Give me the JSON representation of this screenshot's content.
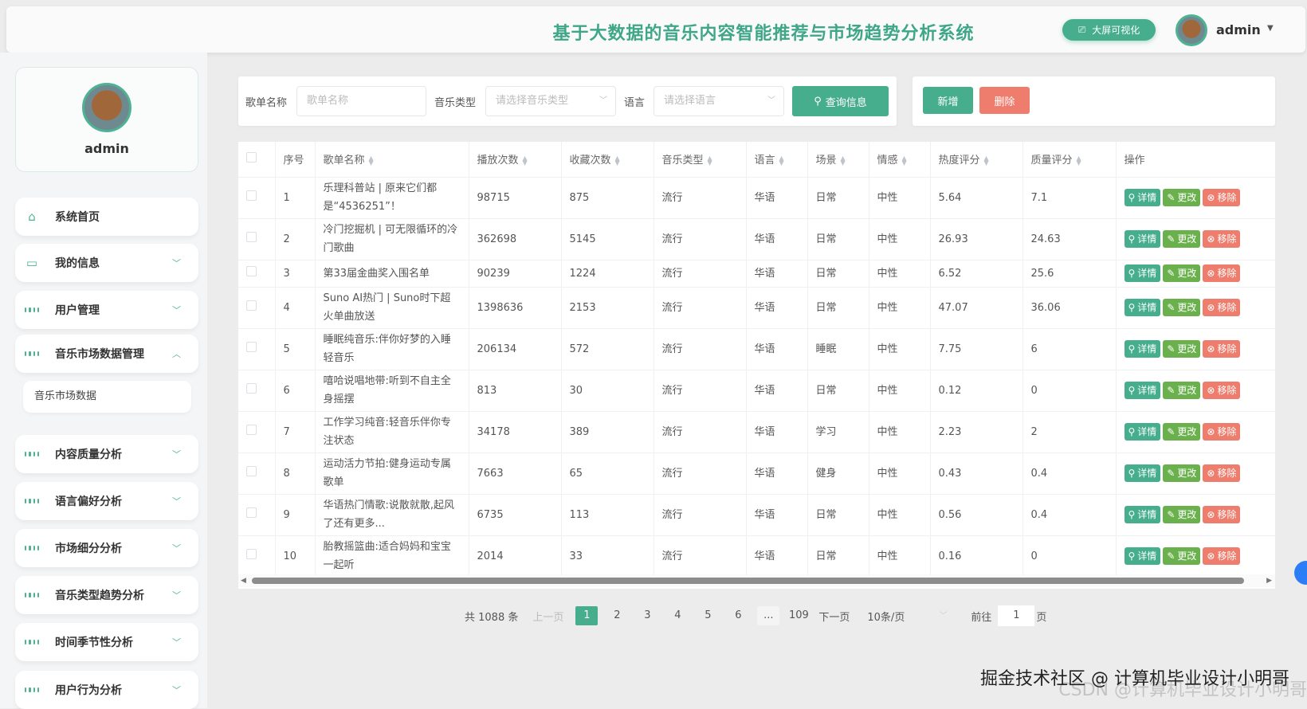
{
  "header": {
    "title": "基于大数据的音乐内容智能推荐与市场趋势分析系统",
    "bigscreen_label": "大屏可视化",
    "username": "admin"
  },
  "sidebar": {
    "profile_name": "admin",
    "items": [
      {
        "label": "系统首页"
      },
      {
        "label": "我的信息"
      },
      {
        "label": "用户管理"
      },
      {
        "label": "音乐市场数据管理"
      },
      {
        "label": "内容质量分析"
      },
      {
        "label": "语言偏好分析"
      },
      {
        "label": "市场细分分析"
      },
      {
        "label": "音乐类型趋势分析"
      },
      {
        "label": "时间季节性分析"
      },
      {
        "label": "用户行为分析"
      }
    ],
    "submenu": [
      "音乐市场数据"
    ]
  },
  "search": {
    "name_label": "歌单名称",
    "name_placeholder": "歌单名称",
    "type_label": "音乐类型",
    "type_placeholder": "请选择音乐类型",
    "lang_label": "语言",
    "lang_placeholder": "请选择语言",
    "query_label": "查询信息"
  },
  "actions": {
    "add_label": "新增",
    "delete_label": "删除"
  },
  "table": {
    "columns": [
      "序号",
      "歌单名称",
      "播放次数",
      "收藏次数",
      "音乐类型",
      "语言",
      "场景",
      "情感",
      "热度评分",
      "质量评分",
      "操作"
    ],
    "op_labels": {
      "detail": "详情",
      "edit": "更改",
      "remove": "移除"
    },
    "rows": [
      [
        "1",
        "乐理科普站 | 原来它们都是“4536251”！",
        "98715",
        "875",
        "流行",
        "华语",
        "日常",
        "中性",
        "5.64",
        "7.1"
      ],
      [
        "2",
        "冷门挖掘机 | 可无限循环的冷门歌曲",
        "362698",
        "5145",
        "流行",
        "华语",
        "日常",
        "中性",
        "26.93",
        "24.63"
      ],
      [
        "3",
        "第33届金曲奖入围名单",
        "90239",
        "1224",
        "流行",
        "华语",
        "日常",
        "中性",
        "6.52",
        "25.6"
      ],
      [
        "4",
        "Suno AI热门 | Suno时下超火单曲放送",
        "1398636",
        "2153",
        "流行",
        "华语",
        "日常",
        "中性",
        "47.07",
        "36.06"
      ],
      [
        "5",
        "睡眠纯音乐:伴你好梦的入睡轻音乐",
        "206134",
        "572",
        "流行",
        "华语",
        "睡眠",
        "中性",
        "7.75",
        "6"
      ],
      [
        "6",
        "嘻哈说唱地带:听到不自主全身摇摆",
        "813",
        "30",
        "流行",
        "华语",
        "日常",
        "中性",
        "0.12",
        "0"
      ],
      [
        "7",
        "工作学习纯音:轻音乐伴你专注状态",
        "34178",
        "389",
        "流行",
        "华语",
        "学习",
        "中性",
        "2.23",
        "2"
      ],
      [
        "8",
        "运动活力节拍:健身运动专属歌单",
        "7663",
        "65",
        "流行",
        "华语",
        "健身",
        "中性",
        "0.43",
        "0.4"
      ],
      [
        "9",
        "华语热门情歌:说散就散,起风了还有更多...",
        "6735",
        "113",
        "流行",
        "华语",
        "日常",
        "中性",
        "0.56",
        "0.4"
      ],
      [
        "10",
        "胎教摇篮曲:适合妈妈和宝宝一起听",
        "2014",
        "33",
        "流行",
        "华语",
        "日常",
        "中性",
        "0.16",
        "0"
      ]
    ]
  },
  "pagination": {
    "total": "共 1088 条",
    "prev": "上一页",
    "pages": [
      "1",
      "2",
      "3",
      "4",
      "5",
      "6"
    ],
    "ellipsis": "...",
    "last": "109",
    "next": "下一页",
    "page_size": "10条/页",
    "goto_label": "前往",
    "goto_value": "1",
    "goto_suffix": "页",
    "current_page": 1
  },
  "watermark": {
    "line1": "掘金技术社区 @ 计算机毕业设计小明哥",
    "line2": "CSDN @计算机毕业设计小明哥"
  },
  "colors": {
    "primary": "#46ad8d",
    "success": "#6ab04c",
    "danger": "#ee7d6e"
  }
}
